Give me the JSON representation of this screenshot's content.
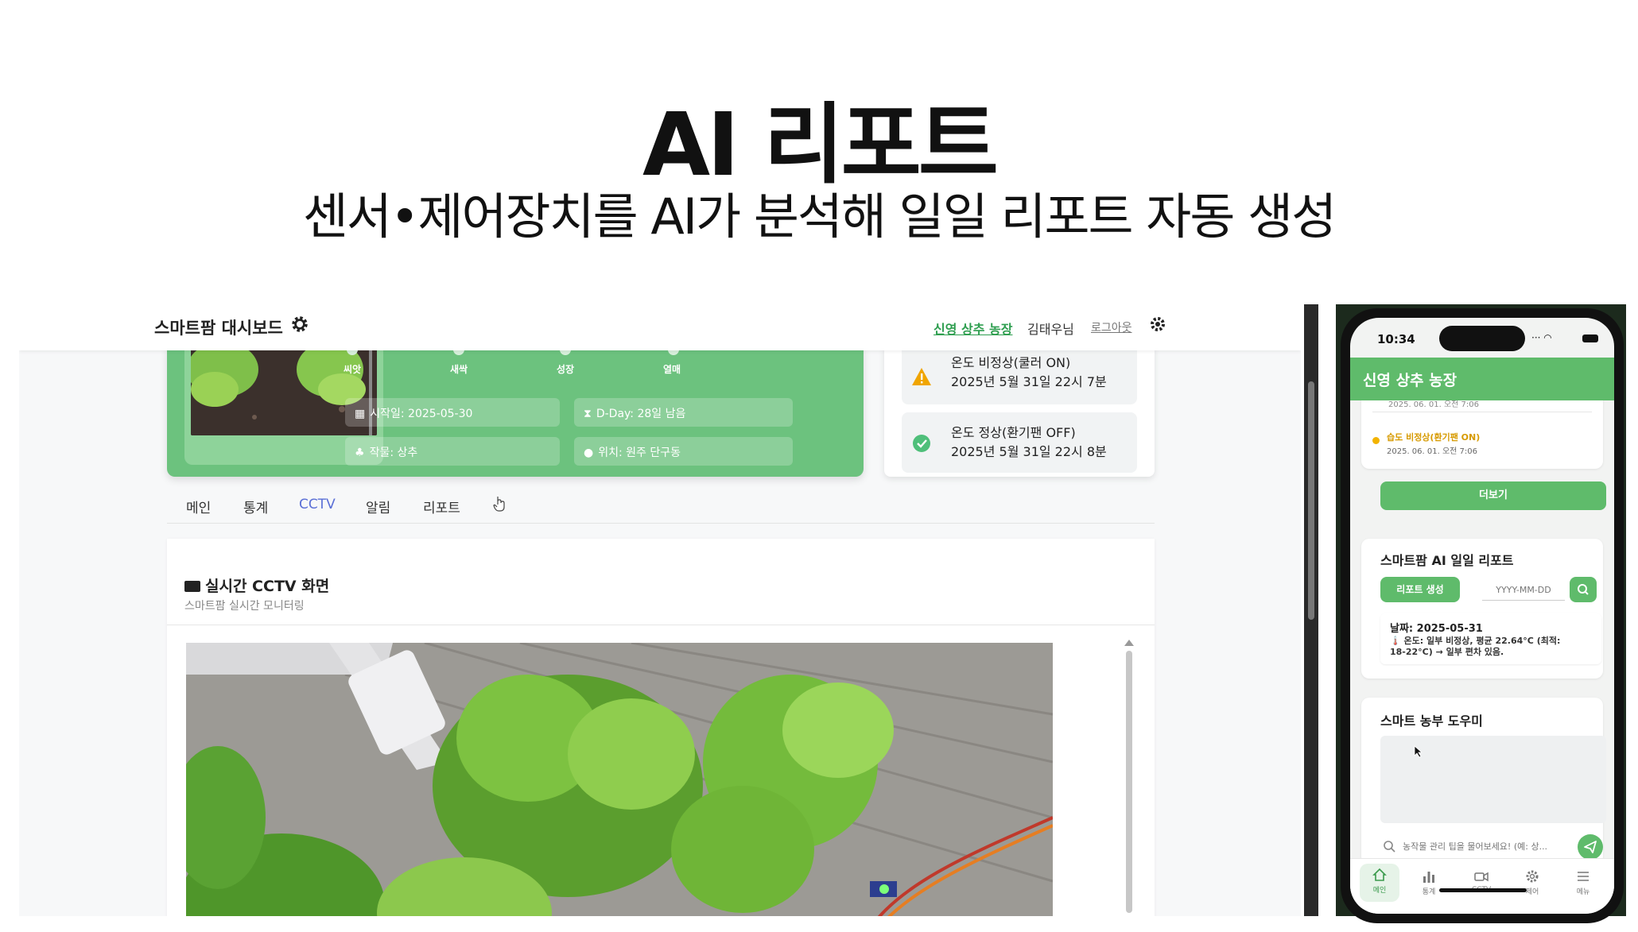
{
  "slide": {
    "title": "AI 리포트",
    "subtitle": "센서•제어장치를 AI가 분석해 일일 리포트 자동 생성"
  },
  "desktop": {
    "header": {
      "title": "스마트팜 대시보드",
      "farm_link": "신영 상추 농장",
      "user": "김태우님",
      "logout": "로그아웃"
    },
    "growth": {
      "stages": [
        "씨앗",
        "새싹",
        "성장",
        "열매"
      ],
      "start_date": "시작일: 2025-05-30",
      "dday": "D-Day: 28일 남음",
      "crop": "작물: 상추",
      "location": "위치: 원주 단구동"
    },
    "alerts": [
      {
        "type": "warning",
        "title": "온도 비정상(쿨러 ON)",
        "time": "2025년 5월 31일 22시 7분"
      },
      {
        "type": "ok",
        "title": "온도 정상(환기팬 OFF)",
        "time": "2025년 5월 31일 22시 8분"
      }
    ],
    "tabs": [
      "메인",
      "통계",
      "CCTV",
      "알림",
      "리포트"
    ],
    "active_tab": "CCTV",
    "cctv": {
      "title": "실시간 CCTV 화면",
      "subtitle": "스마트팜 실시간 모니터링"
    }
  },
  "mobile": {
    "status_time": "10:34",
    "app_title": "신영 상추 농장",
    "prev_alert_date": "2025. 06. 01. 오전 7:06",
    "alert": {
      "text": "습도 비정상(환기팬 ON)",
      "date": "2025. 06. 01. 오전 7:06"
    },
    "more_button": "더보기",
    "report": {
      "title": "스마트팜 AI 일일 리포트",
      "generate_button": "리포트 생성",
      "date_placeholder": "YYYY-MM-DD",
      "date": "날짜: 2025-05-31",
      "line1": "🌡️ 온도: 일부 비정상, 평균 22.64°C (최적:",
      "line2": "18-22°C) → 일부 편차 있음."
    },
    "helper": {
      "title": "스마트 농부 도우미",
      "input_placeholder": "농작물 관리 팁을 물어보세요! (예: 상..."
    },
    "nav": [
      "메인",
      "통계",
      "CCTV",
      "제어",
      "메뉴"
    ]
  },
  "colors": {
    "brand_green": "#5fbb6b",
    "card_green": "#6cc27e",
    "active_tab": "#5a6fd6",
    "warning": "#f2b300"
  }
}
